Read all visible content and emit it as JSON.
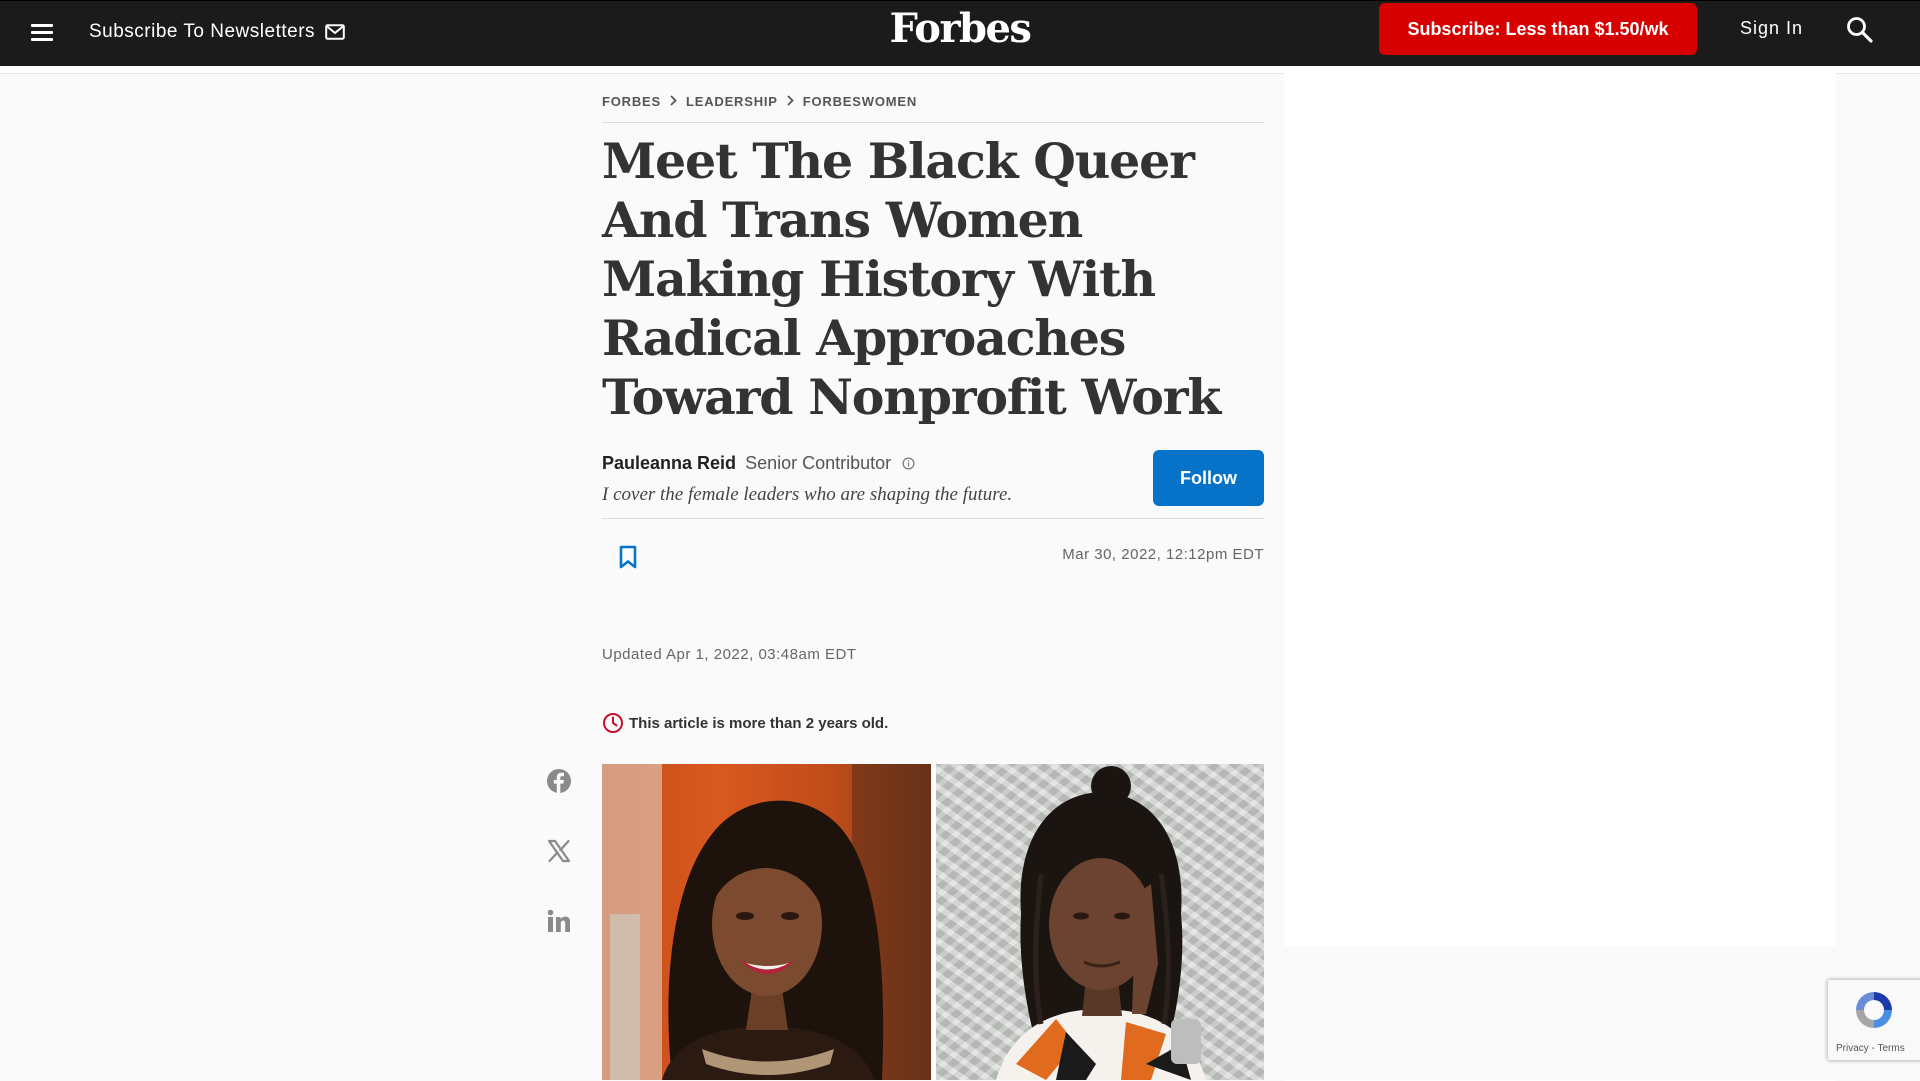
{
  "header": {
    "menu_icon": "hamburger-menu-icon",
    "newsletter_label": "Subscribe To Newsletters",
    "newsletter_icon": "envelope-icon",
    "logo_text": "Forbes",
    "subscribe_label": "Subscribe: Less than $1.50/wk",
    "signin_label": "Sign In",
    "search_icon": "search-icon",
    "subscribe_color": "#d60000"
  },
  "breadcrumb": {
    "items": [
      {
        "label": "FORBES"
      },
      {
        "label": "LEADERSHIP"
      },
      {
        "label": "FORBESWOMEN"
      }
    ],
    "separator_icon": "chevron-right-icon"
  },
  "article": {
    "headline": "Meet The Black Queer And Trans Women Making History With Radical Approaches Toward Nonprofit Work",
    "author": {
      "name": "Pauleanna Reid",
      "role": "Senior Contributor",
      "bio": "I cover the female leaders who are shaping the future."
    },
    "follow_label": "Follow",
    "follow_color": "#0673c9",
    "published": "Mar 30, 2022, 12:12pm EDT",
    "updated": "Updated Apr 1, 2022, 03:48am EDT",
    "age_notice": "This article is more than 2 years old.",
    "notice_color": "#c8102e",
    "bookmark_icon": "bookmark-icon"
  },
  "share": {
    "items": [
      {
        "icon": "facebook-icon"
      },
      {
        "icon": "x-twitter-icon"
      },
      {
        "icon": "linkedin-icon"
      }
    ]
  },
  "recaptcha": {
    "terms": "Privacy - Terms"
  }
}
